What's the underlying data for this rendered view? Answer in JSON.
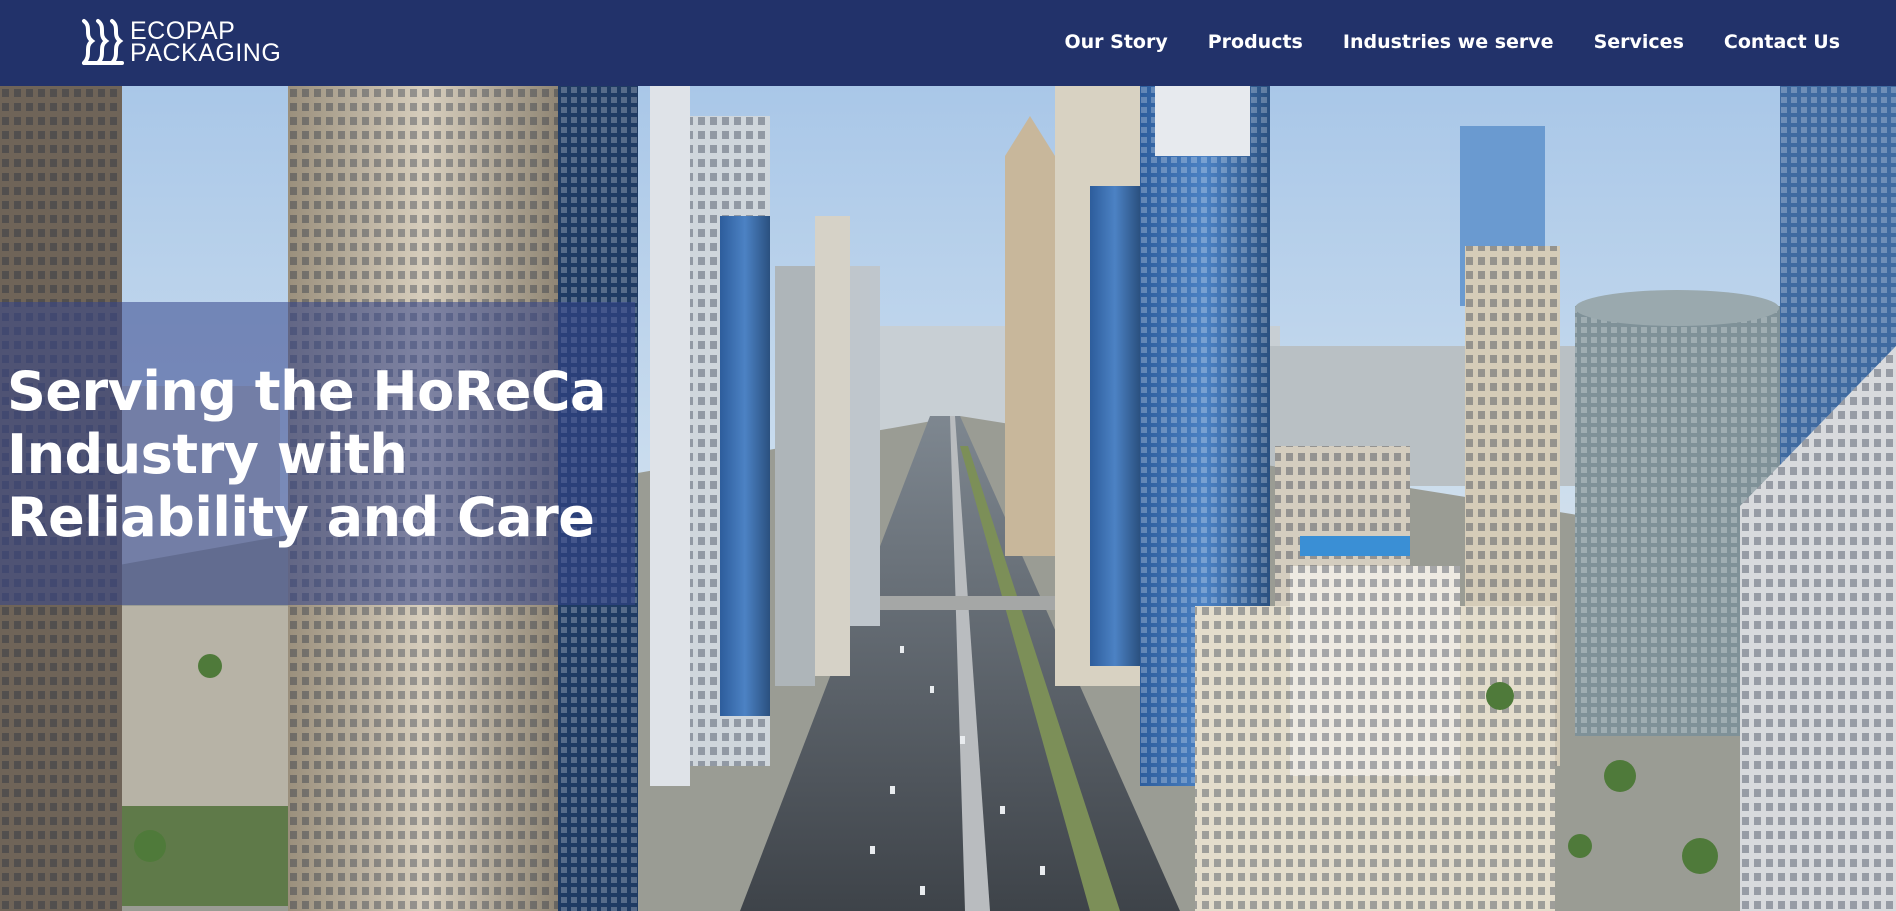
{
  "brand": {
    "name_line1": "ECOPAP",
    "name_line2": "PACKAGING",
    "logo_icon": "ecopap-logo-icon"
  },
  "nav": {
    "items": [
      {
        "label": "Our Story"
      },
      {
        "label": "Products"
      },
      {
        "label": "Industries we serve"
      },
      {
        "label": "Services"
      },
      {
        "label": "Contact Us"
      }
    ]
  },
  "hero": {
    "title": "Serving the HoReCa Industry with Reliability and Care",
    "background": "city-highway-skyline-photo"
  },
  "colors": {
    "header_bg": "#22326a",
    "overlay_band": "#34468c",
    "text": "#ffffff",
    "sky": "#aecbea"
  }
}
